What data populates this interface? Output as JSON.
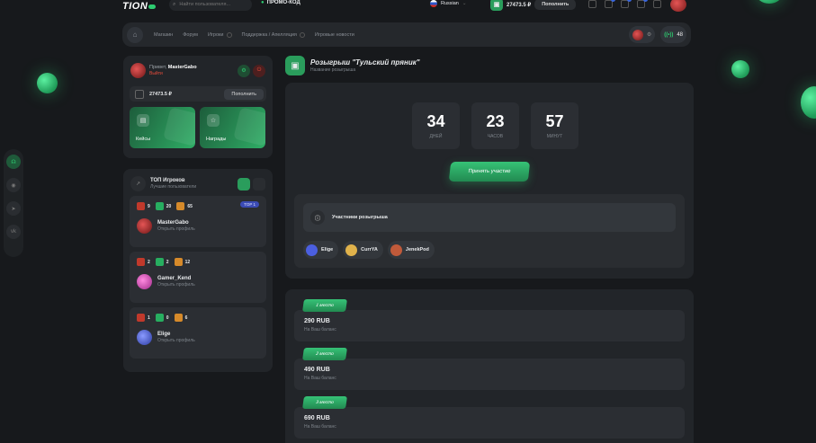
{
  "header": {
    "logo": "TION",
    "search_placeholder": "Найти пользователя...",
    "promo_label": "ПРОМО-КОД",
    "language": "Russian",
    "balance": "27473.5 ₽",
    "topup_label": "Пополнить"
  },
  "nav": {
    "items": [
      "Магазин",
      "Форум",
      "Игроки",
      "Поддержка / Апелляция",
      "Игровые новости"
    ],
    "online_count": "48"
  },
  "profile": {
    "greeting": "Привет,",
    "name": "MasterGabo",
    "exit_label": "Выйти",
    "balance": "27473.5 ₽",
    "topup_label": "Пополнить",
    "tiles": [
      {
        "label": "Кейсы",
        "icon": "case-icon"
      },
      {
        "label": "Награды",
        "icon": "star-icon"
      }
    ]
  },
  "top_players": {
    "title": "ТОП Игроков",
    "subtitle": "Лучшие пользователи",
    "profile_link": "Открыть профиль",
    "badge": "TOP 1",
    "players": [
      {
        "name": "MasterGabo",
        "red": "9",
        "green": "20",
        "orange": "65",
        "avatar_color": "#c0392b"
      },
      {
        "name": "Gamer_Kend",
        "red": "2",
        "green": "2",
        "orange": "12",
        "avatar_color": "#e056c4"
      },
      {
        "name": "Elige",
        "red": "1",
        "green": "0",
        "orange": "6",
        "avatar_color": "#4b5fe0"
      }
    ]
  },
  "giveaway": {
    "title": "Розыгрыш \"Тульский пряник\"",
    "subtitle": "Название розыгрыша",
    "timer": [
      {
        "value": "34",
        "label": "ДНЕЙ"
      },
      {
        "value": "23",
        "label": "ЧАСОВ"
      },
      {
        "value": "57",
        "label": "МИНУТ"
      }
    ],
    "join_label": "Принять участие",
    "participants_title": "Участники розыгрыша",
    "participants": [
      {
        "name": "Elige",
        "color": "#4b5fe0"
      },
      {
        "name": "CurrYA",
        "color": "#e0b24b"
      },
      {
        "name": "JenekPod",
        "color": "#c05a3a"
      }
    ],
    "prizes": [
      {
        "place": "1 место",
        "amount": "290 RUB",
        "note": "На Ваш баланс"
      },
      {
        "place": "2 место",
        "amount": "490 RUB",
        "note": "На Ваш баланс"
      },
      {
        "place": "3 место",
        "amount": "690 RUB",
        "note": "На Ваш баланс"
      }
    ]
  },
  "colors": {
    "accent": "#2ecc71",
    "background": "#17191c",
    "card": "#222529"
  }
}
